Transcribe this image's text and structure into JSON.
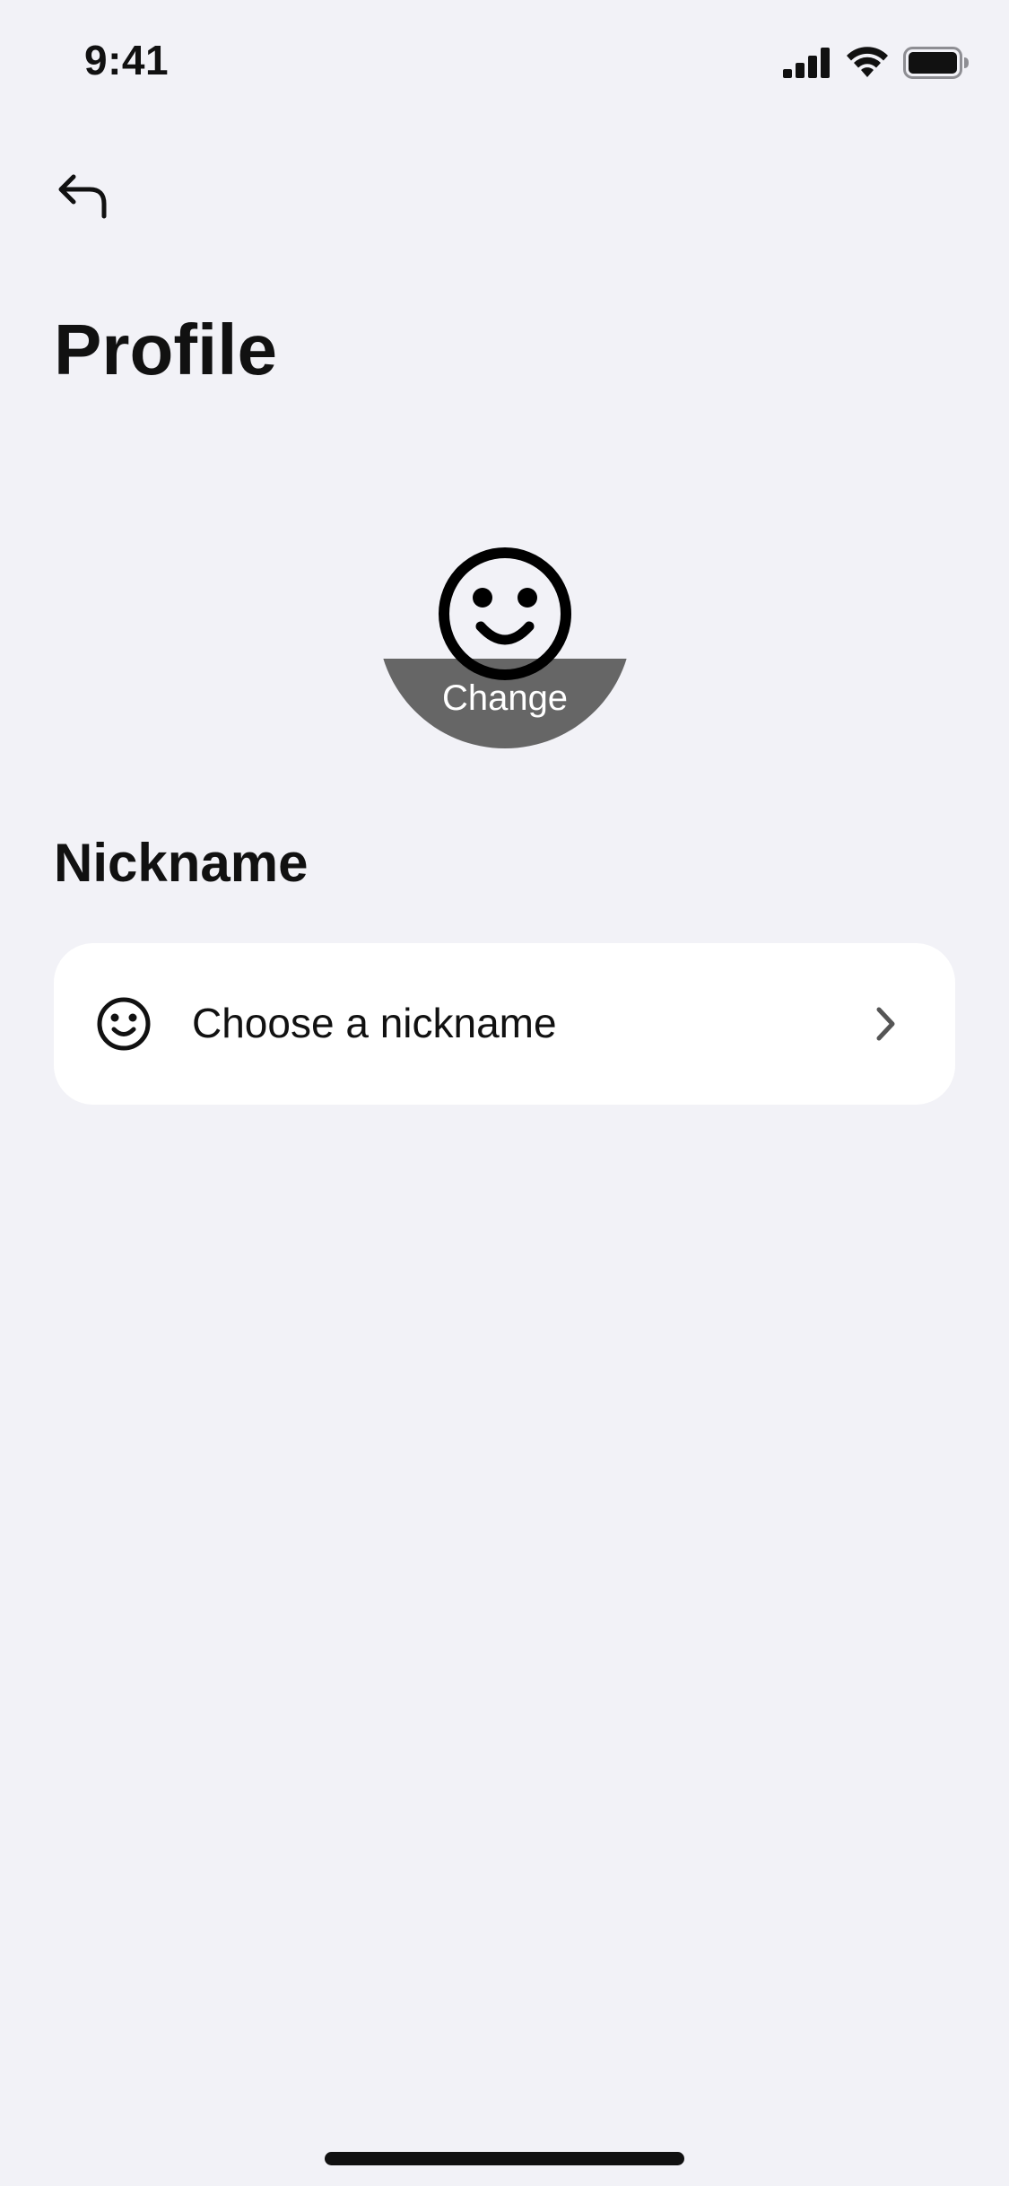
{
  "status_bar": {
    "time": "9:41",
    "icons": [
      "cellular-signal-icon",
      "wifi-icon",
      "battery-icon"
    ]
  },
  "navigation": {
    "back_icon": "back-arrow-icon"
  },
  "page": {
    "title": "Profile"
  },
  "avatar": {
    "icon": "smiley-face-icon",
    "change_label": "Change"
  },
  "nickname_section": {
    "heading": "Nickname",
    "row": {
      "icon": "smiley-face-icon",
      "label": "Choose a nickname",
      "accessory_icon": "chevron-right-icon"
    }
  },
  "colors": {
    "background": "#f2f2f7",
    "card": "#ffffff",
    "avatar_band": "#666666",
    "text": "#111111",
    "chevron": "#555555"
  }
}
